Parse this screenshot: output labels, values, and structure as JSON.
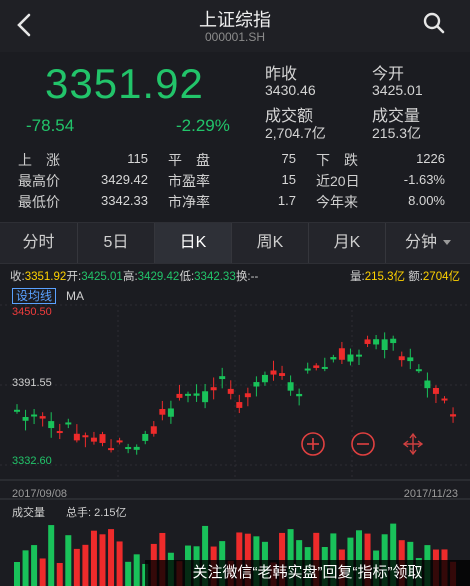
{
  "header": {
    "title": "上证综指",
    "code": "000001.SH"
  },
  "quote": {
    "price": "3351.92",
    "change": "-78.54",
    "change_pct": "-2.29%",
    "prev_close_label": "昨收",
    "prev_close": "3430.46",
    "open_label": "今开",
    "open": "3425.01",
    "amount_label": "成交额",
    "amount": "2,704.7亿",
    "volume_label": "成交量",
    "volume": "215.3亿"
  },
  "stats": {
    "up_label": "上　涨",
    "up": "115",
    "flat_label": "平　盘",
    "flat": "75",
    "down_label": "下　跌",
    "down": "1226",
    "high_label": "最高价",
    "high": "3429.42",
    "pe_label": "市盈率",
    "pe": "15",
    "d20_label": "近20日",
    "d20": "-1.63%",
    "low_label": "最低价",
    "low": "3342.33",
    "pb_label": "市净率",
    "pb": "1.7",
    "ytd_label": "今年来",
    "ytd": "8.00%"
  },
  "tabs": [
    "分时",
    "5日",
    "日K",
    "周K",
    "月K",
    "分钟"
  ],
  "infoline": {
    "close_label": "收:",
    "close": "3351.92",
    "open_label": "开:",
    "open": "3425.01",
    "high_label": "高:",
    "high": "3429.42",
    "low_label": "低:",
    "low": "3342.33",
    "turnover_label": "换:",
    "turnover": "--",
    "vol_label": "量:",
    "vol": "215.3亿",
    "amt_label": "额:",
    "amt": "2704亿"
  },
  "chart": {
    "ma_button": "设均线",
    "ma_label": "MA",
    "axis_high": "3450.50",
    "axis_mid": "3391.55",
    "axis_low": "3332.60",
    "date_start": "2017/09/08",
    "date_end": "2017/11/23",
    "volume_label": "成交量",
    "hand_label": "总手: 2.15亿"
  },
  "banner": "关注微信“老韩实盘”回复“指标”领取"
}
